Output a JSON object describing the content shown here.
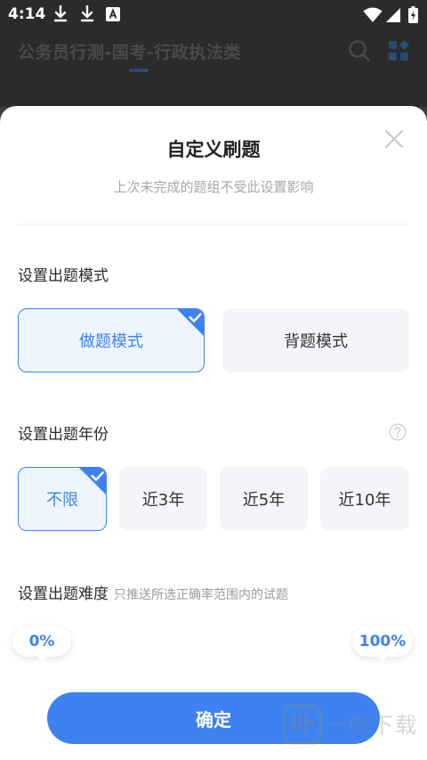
{
  "status_bar": {
    "time": "4:14",
    "icons": [
      "download-icon",
      "download-icon",
      "notification-a-icon",
      "wifi-icon",
      "signal-icon",
      "battery-charging-icon"
    ]
  },
  "app_header": {
    "title": "公务员行测-国考-行政执法类",
    "icons": [
      "search-icon",
      "grid-menu-icon"
    ]
  },
  "modal": {
    "title": "自定义刷题",
    "subtitle": "上次未完成的题组不受此设置影响",
    "close_icon": "close-icon",
    "mode_section": {
      "label": "设置出题模式",
      "options": [
        {
          "label": "做题模式",
          "selected": true
        },
        {
          "label": "背题模式",
          "selected": false
        }
      ]
    },
    "year_section": {
      "label": "设置出题年份",
      "help_icon": "question-circle-icon",
      "options": [
        {
          "label": "不限",
          "selected": true
        },
        {
          "label": "近3年",
          "selected": false
        },
        {
          "label": "近5年",
          "selected": false
        },
        {
          "label": "近10年",
          "selected": false
        }
      ]
    },
    "difficulty_section": {
      "label": "设置出题难度",
      "hint": "只推送所选正确率范围内的试题",
      "min_value": "0%",
      "max_value": "100%"
    },
    "confirm_label": "确定"
  },
  "watermark": {
    "text": "一听下载",
    "icon": "watermark-logo-icon"
  },
  "colors": {
    "accent": "#3d82f0",
    "selected_bg": "#eef5ff",
    "option_bg": "#f4f5f8"
  }
}
